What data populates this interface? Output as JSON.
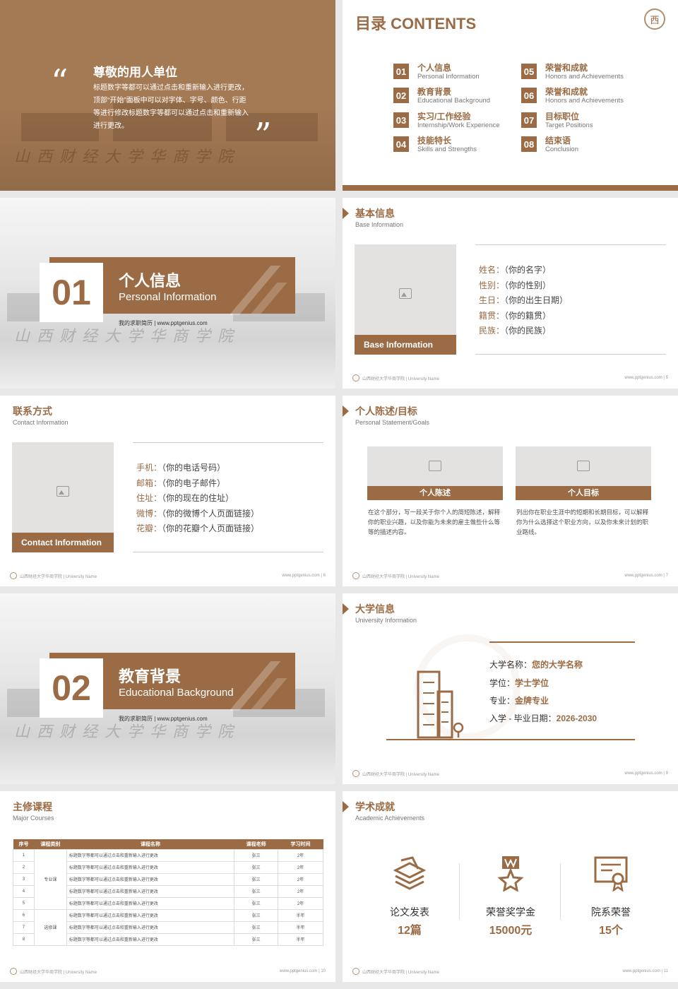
{
  "colors": {
    "accent": "#9a6b44"
  },
  "slide1": {
    "title": "尊敬的用人单位",
    "body": "标题数字等都可以通过点击和重新输入进行更改，顶部“开始”面板中可以对字体、字号、颜色、行距等进行修改标题数字等都可以通过点击和重新输入进行更改。",
    "sign": "山西财经大学华商学院"
  },
  "contents": {
    "title": "目录 CONTENTS",
    "logo": "西",
    "items": [
      {
        "num": "01",
        "zh": "个人信息",
        "en": "Personal Information"
      },
      {
        "num": "02",
        "zh": "教育背景",
        "en": "Educational Background"
      },
      {
        "num": "03",
        "zh": "实习/工作经验",
        "en": "Internship/Work Experience"
      },
      {
        "num": "04",
        "zh": "技能特长",
        "en": "Skills and Strengths"
      },
      {
        "num": "05",
        "zh": "荣誉和成就",
        "en": "Honors and Achievements"
      },
      {
        "num": "06",
        "zh": "荣誉和成就",
        "en": "Honors and Achievements"
      },
      {
        "num": "07",
        "zh": "目标职位",
        "en": "Target Positions"
      },
      {
        "num": "08",
        "zh": "结束语",
        "en": "Conclusion"
      }
    ]
  },
  "section1": {
    "num": "01",
    "zh": "个人信息",
    "en": "Personal Information",
    "site": "我的求职简历 | www.pptgenius.com",
    "sign": "山西财经大学华商学院"
  },
  "section2": {
    "num": "02",
    "zh": "教育背景",
    "en": "Educational Background",
    "site": "我的求职简历 | www.pptgenius.com",
    "sign": "山西财经大学华商学院"
  },
  "footer": {
    "left": "山西财经大学华商学院 | University Name",
    "site": "www.pptgenius.com"
  },
  "base": {
    "zh": "基本信息",
    "en": "Base Information",
    "caption": "Base Information",
    "page": "5",
    "rows": [
      {
        "k": "姓名：",
        "v": "（你的名字）"
      },
      {
        "k": "性别：",
        "v": "（你的性别）"
      },
      {
        "k": "生日：",
        "v": "（你的出生日期）"
      },
      {
        "k": "籍贯：",
        "v": "（你的籍贯）"
      },
      {
        "k": "民族：",
        "v": "（你的民族）"
      }
    ]
  },
  "contact": {
    "zh": "联系方式",
    "en": "Contact Information",
    "caption": "Contact Information",
    "page": "6",
    "rows": [
      {
        "k": "手机：",
        "v": "（你的电话号码）"
      },
      {
        "k": "邮箱：",
        "v": "（你的电子邮件）"
      },
      {
        "k": "住址：",
        "v": "（你的现在的住址）"
      },
      {
        "k": "微博：",
        "v": "（你的微博个人页面链接）"
      },
      {
        "k": "花瓣：",
        "v": "（你的花瓣个人页面链接）"
      }
    ]
  },
  "statement": {
    "zh": "个人陈述/目标",
    "en": "Personal Statement/Goals",
    "page": "7",
    "cards": [
      {
        "label": "个人陈述",
        "text": "在这个部分，写一段关于你个人的简短陈述，解释你的职业兴趣，以及你能为未来的雇主做些什么等等的描述内容。"
      },
      {
        "label": "个人目标",
        "text": "列出你在职业生涯中的短期和长期目标，可以解释你为什么选择这个职业方向，以及你未来计划的职业路线。"
      }
    ]
  },
  "university": {
    "zh": "大学信息",
    "en": "University Information",
    "page": "9",
    "rows": [
      {
        "k": "大学名称：",
        "v": "您的大学名称"
      },
      {
        "k": "学位：",
        "v": "学士学位"
      },
      {
        "k": "专业：",
        "v": "金牌专业"
      },
      {
        "k": "入学 - 毕业日期：",
        "v": "2026-2030"
      }
    ]
  },
  "courses": {
    "zh": "主修课程",
    "en": "Major Courses",
    "page": "10",
    "headers": [
      "序号",
      "课程类别",
      "课程名称",
      "课程老师",
      "学习时间"
    ],
    "rows": [
      {
        "n": "1",
        "name": "标题数字等都可以通过点击和重新输入进行更改",
        "t": "张三",
        "time": "2年"
      },
      {
        "n": "2",
        "name": "标题数字等都可以通过点击和重新输入进行更改",
        "t": "张三",
        "time": "2年"
      },
      {
        "n": "3",
        "name": "标题数字等都可以通过点击和重新输入进行更改",
        "t": "张三",
        "time": "2年"
      },
      {
        "n": "4",
        "name": "标题数字等都可以通过点击和重新输入进行更改",
        "t": "张三",
        "time": "2年"
      },
      {
        "n": "5",
        "name": "标题数字等都可以通过点击和重新输入进行更改",
        "t": "张三",
        "time": "2年"
      },
      {
        "n": "6",
        "name": "标题数字等都可以通过点击和重新输入进行更改",
        "t": "张三",
        "time": "半年"
      },
      {
        "n": "7",
        "name": "标题数字等都可以通过点击和重新输入进行更改",
        "t": "张三",
        "time": "半年"
      },
      {
        "n": "8",
        "name": "标题数字等都可以通过点击和重新输入进行更改",
        "t": "张三",
        "time": "半年"
      }
    ],
    "cat1": "专业课",
    "cat2": "选修课"
  },
  "academic": {
    "zh": "学术成就",
    "en": "Academic Achievements",
    "page": "11",
    "items": [
      {
        "name": "论文发表",
        "val": "12篇",
        "icon": "stack-papers-icon"
      },
      {
        "name": "荣誉奖学金",
        "val": "15000元",
        "icon": "medal-icon"
      },
      {
        "name": "院系荣誉",
        "val": "15个",
        "icon": "certificate-icon"
      }
    ]
  }
}
